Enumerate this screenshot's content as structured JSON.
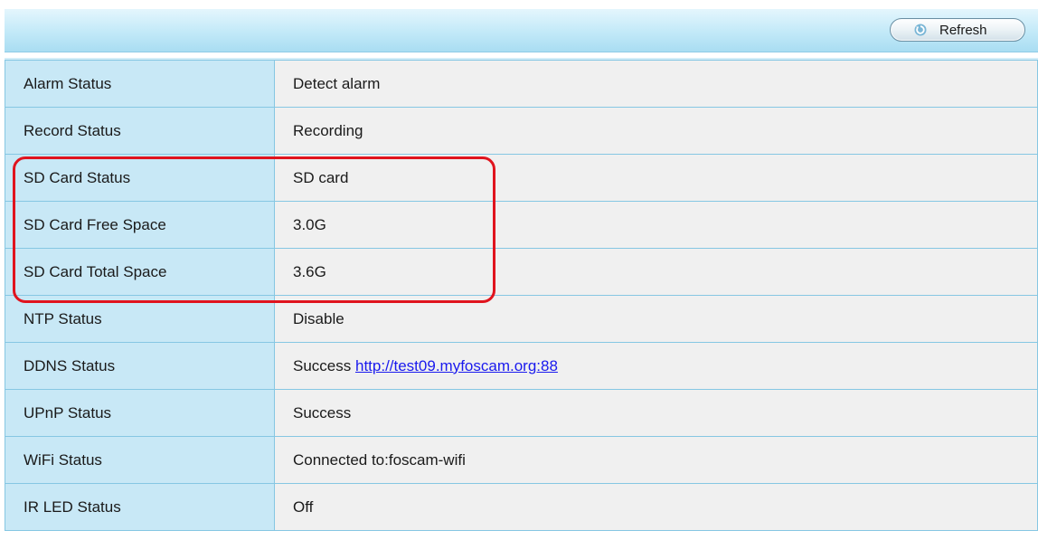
{
  "toolbar": {
    "refresh_label": "Refresh",
    "refresh_icon": "refresh-icon"
  },
  "rows": [
    {
      "label": "Alarm Status",
      "value": "Detect alarm"
    },
    {
      "label": "Record Status",
      "value": "Recording"
    },
    {
      "label": "SD Card Status",
      "value": "SD card"
    },
    {
      "label": "SD Card Free Space",
      "value": "3.0G"
    },
    {
      "label": "SD Card Total Space",
      "value": "3.6G"
    },
    {
      "label": "NTP Status",
      "value": "Disable"
    },
    {
      "label": "DDNS Status",
      "value": "Success",
      "link": "http://test09.myfoscam.org:88"
    },
    {
      "label": "UPnP Status",
      "value": "Success"
    },
    {
      "label": "WiFi Status",
      "value": "Connected to:foscam-wifi"
    },
    {
      "label": "IR LED Status",
      "value": "Off"
    }
  ],
  "colors": {
    "label_bg": "#c8e8f6",
    "value_bg": "#f0f0f0",
    "border": "#86c7e3",
    "highlight": "#e0141e",
    "link": "#1a1aee"
  }
}
